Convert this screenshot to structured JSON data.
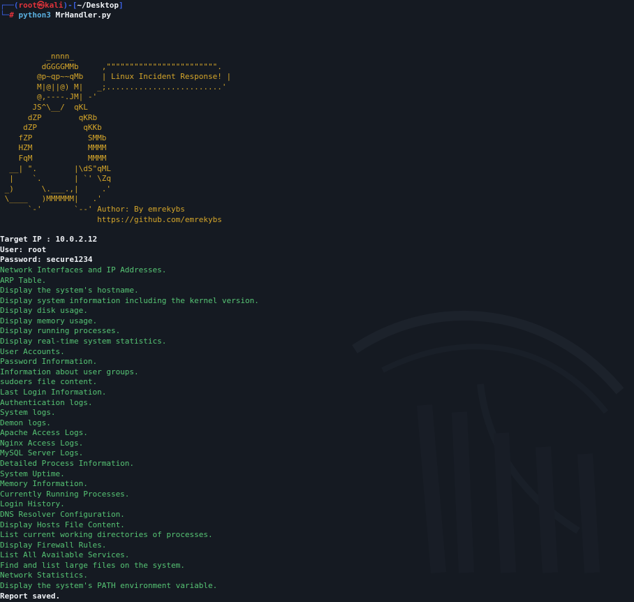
{
  "prompt": {
    "user": "root",
    "at_symbol": "㉿",
    "host": "kali",
    "path": "~/Desktop",
    "symbol": "#",
    "command": "python3",
    "argument": "MrHandler.py"
  },
  "banner": {
    "ascii_art": "          _nnnn_\n         dGGGGMMb     ,\"\"\"\"\"\"\"\"\"\"\"\"\"\"\"\"\"\"\"\"\"\"\"\".\n        @p~qp~~qMb    | Linux Incident Response! |\n        M|@||@) M|   _;.........................'\n        @,----.JM| -'\n       JS^\\__/  qKL\n      dZP        qKRb\n     dZP          qKKb\n    fZP            SMMb\n    HZM            MMMM\n    FqM            MMMM\n  __| \".        |\\dS\"qML\n  |    `.       | `' \\Zq\n _)      \\.___.,|     .'\n \\____   )MMMMMM|   .'\n      `-'       `--' Author: By emrekybs\n                     https://github.com/emrekybs"
  },
  "session": {
    "target_ip": "Target IP : 10.0.2.12",
    "user": "User: root",
    "password": "Password: secure1234"
  },
  "output_lines": [
    "Network Interfaces and IP Addresses.",
    "ARP Table.",
    "Display the system's hostname.",
    "Display system information including the kernel version.",
    "Display disk usage.",
    "Display memory usage.",
    "Display running processes.",
    "Display real-time system statistics.",
    "User Accounts.",
    "Password Information.",
    "Information about user groups.",
    "sudoers file content.",
    "Last Login Information.",
    "Authentication logs.",
    "System logs.",
    "Demon logs.",
    "Apache Access Logs.",
    "Nginx Access Logs.",
    "MySQL Server Logs.",
    "Detailed Process Information.",
    "System Uptime.",
    "Memory Information.",
    "Currently Running Processes.",
    "Login History.",
    "DNS Resolver Configuration.",
    "Display Hosts File Content.",
    "List current working directories of processes.",
    "Display Firewall Rules.",
    "List All Available Services.",
    "Find and list large files on the system.",
    "Network Statistics.",
    "Display the system's PATH environment variable."
  ],
  "final_line": "Report saved.",
  "colors": {
    "background": "#151a22",
    "prompt_frame": "#3b5fe0",
    "prompt_user": "#e0333a",
    "banner": "#d4a52a",
    "info": "#eef1f5",
    "output": "#56c474"
  }
}
